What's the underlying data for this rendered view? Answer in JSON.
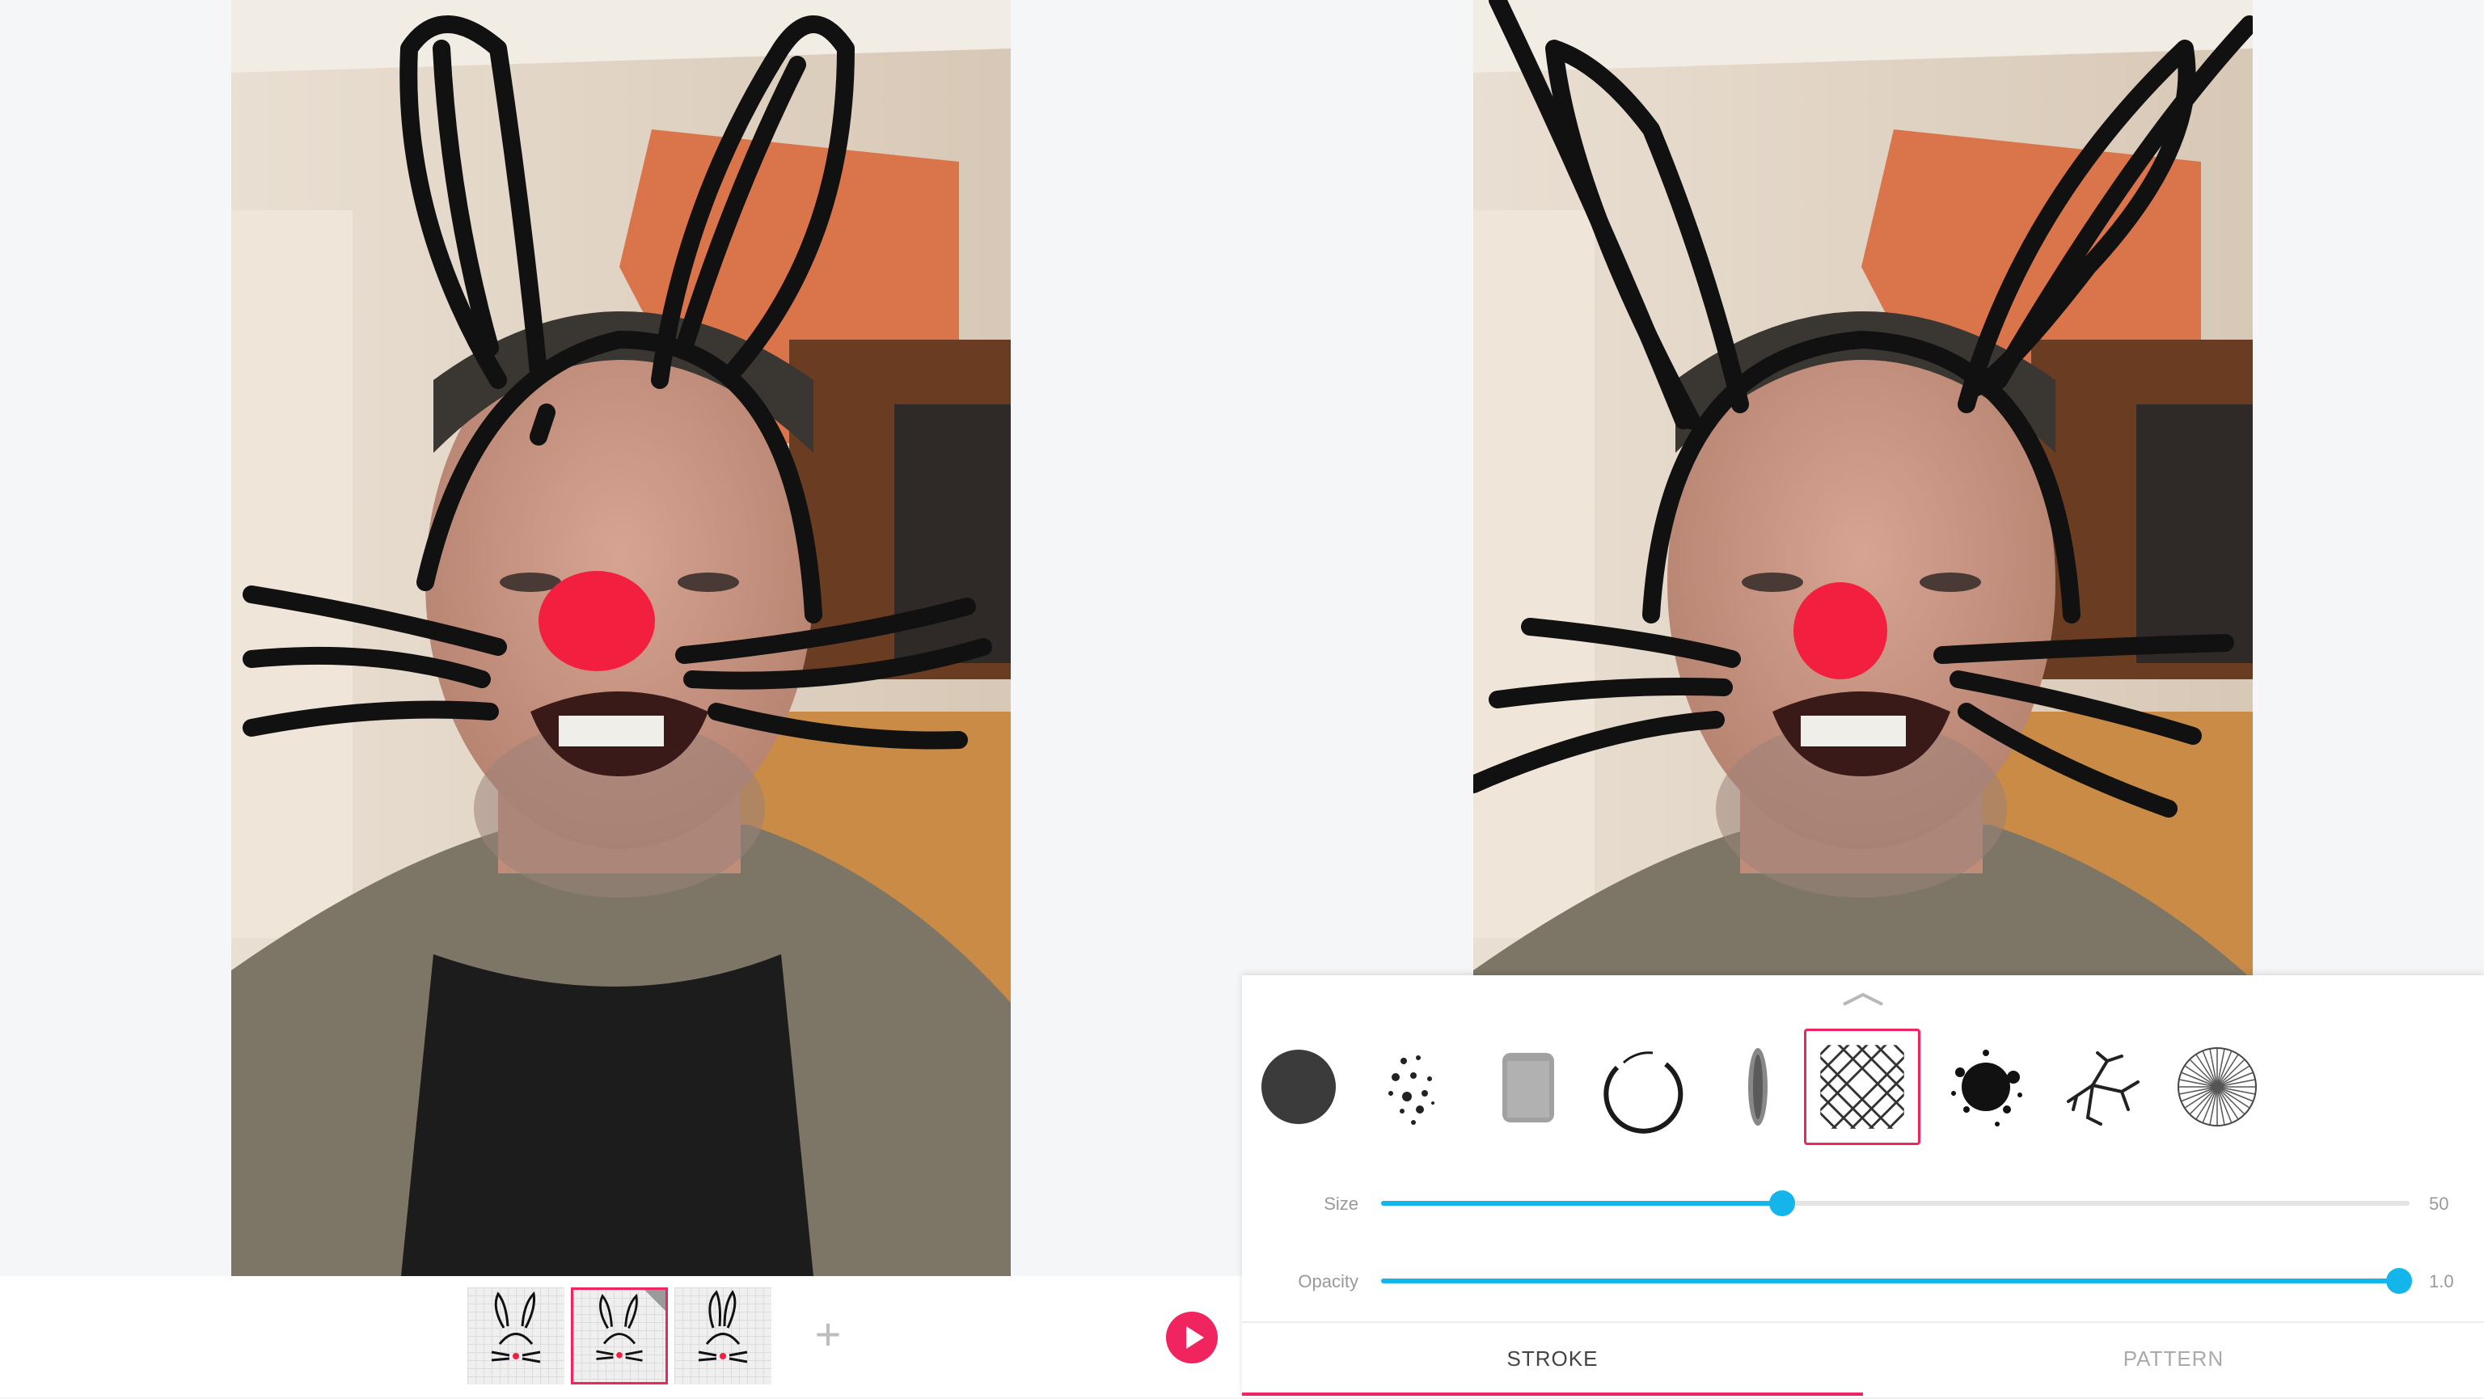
{
  "colors": {
    "accent": "#f0245f",
    "slider": "#13b5ea",
    "nose": "#f2203e",
    "stroke": "#111111"
  },
  "frames": {
    "items": [
      {
        "icon": "bunny-face-thumbnail",
        "selected": false
      },
      {
        "icon": "bunny-face-thumbnail",
        "selected": true
      },
      {
        "icon": "bunny-face-thumbnail",
        "selected": false
      }
    ],
    "add_label": "+",
    "play_icon": "play-icon"
  },
  "brush_panel": {
    "handle_icon": "chevron-up-icon",
    "brushes": [
      {
        "icon": "solid-round-brush-icon",
        "selected": false
      },
      {
        "icon": "dots-brush-icon",
        "selected": false
      },
      {
        "icon": "chalk-brush-icon",
        "selected": false
      },
      {
        "icon": "ring-brush-icon",
        "selected": false
      },
      {
        "icon": "airbrush-icon",
        "selected": false
      },
      {
        "icon": "crosshatch-brush-icon",
        "selected": true
      },
      {
        "icon": "splatter-brush-icon",
        "selected": false
      },
      {
        "icon": "crack-brush-icon",
        "selected": false
      },
      {
        "icon": "radial-lines-brush-icon",
        "selected": false
      }
    ],
    "size": {
      "label": "Size",
      "max": "50",
      "value_fraction": 0.39
    },
    "opacity": {
      "label": "Opacity",
      "max": "1.0",
      "value_fraction": 0.99
    },
    "tabs": [
      {
        "label": "STROKE",
        "active": true
      },
      {
        "label": "PATTERN",
        "active": false
      }
    ]
  }
}
